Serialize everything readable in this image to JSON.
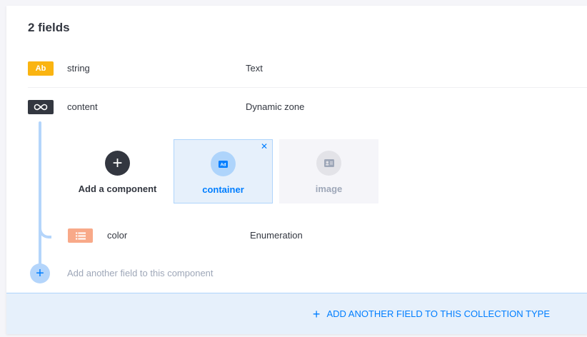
{
  "header": {
    "title": "2 fields"
  },
  "fields": [
    {
      "icon_text": "Ab",
      "icon": "text-icon",
      "name": "string",
      "type": "Text",
      "color": "#fab411"
    },
    {
      "icon": "dynamic-zone-icon",
      "name": "content",
      "type": "Dynamic zone",
      "color": "#333740"
    }
  ],
  "dynamic_zone": {
    "add_component_label": "Add a component",
    "components": [
      {
        "label": "container",
        "icon": "ad-icon",
        "selected": true
      },
      {
        "label": "image",
        "icon": "id-card-icon",
        "selected": false
      }
    ],
    "close_icon": "close-icon"
  },
  "component_fields": [
    {
      "icon": "list-icon",
      "name": "color",
      "type": "Enumeration",
      "color": "#f8a989"
    }
  ],
  "add_component_field": {
    "label": "Add another field to this component"
  },
  "footer": {
    "label": "ADD ANOTHER FIELD TO THIS COLLECTION TYPE"
  },
  "colors": {
    "accent": "#007eff",
    "light_blue": "#b4d5fb",
    "panel_bg": "#ffffff",
    "footer_bg": "#e6f0fb"
  }
}
